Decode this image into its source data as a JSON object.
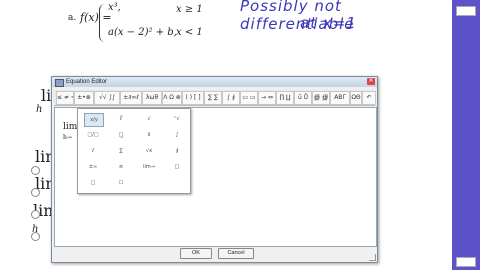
{
  "document": {
    "part_label": "a.",
    "f_lhs": "f(x) =",
    "case1_expr": "x³,",
    "case1_cond": "x ≥ 1",
    "case2_expr": "a(x − 2)² + b,",
    "case2_cond": "x < 1",
    "handwritten_line1": "Possibly not differentiable",
    "handwritten_line2": "at x=1",
    "lim_text": "lim",
    "lim_sub": "h→",
    "lim_h": "h"
  },
  "dialog": {
    "title": "Equation Editor",
    "toolbar": [
      "≤ ≠ ≈",
      "±•⊗",
      "√√ ∫∫",
      "±∂∞ℓ",
      "λωθ",
      "Λ Ω ⊗",
      "( ) [ ]",
      "∑ ∑",
      "∫ ∮",
      "▭ ▭",
      "→ ⇔",
      "∏ ∐",
      "ŭ Ů",
      "∰ ∰",
      "ΑΒΓ",
      "ΩΘ"
    ],
    "palette": [
      [
        "x/y",
        "∛",
        "√",
        "ⁿ√"
      ],
      [
        "□/□",
        "□̲",
        "x̄",
        "∫"
      ],
      [
        "√̄",
        "∑",
        "√x",
        "∮"
      ],
      [
        "±∞",
        "≡",
        "lim→",
        "□"
      ],
      [
        "□",
        "☐",
        "",
        ""
      ]
    ],
    "editor_text": "lim",
    "editor_sub": "h→",
    "ok_label": "OK",
    "cancel_label": "Cancel"
  }
}
